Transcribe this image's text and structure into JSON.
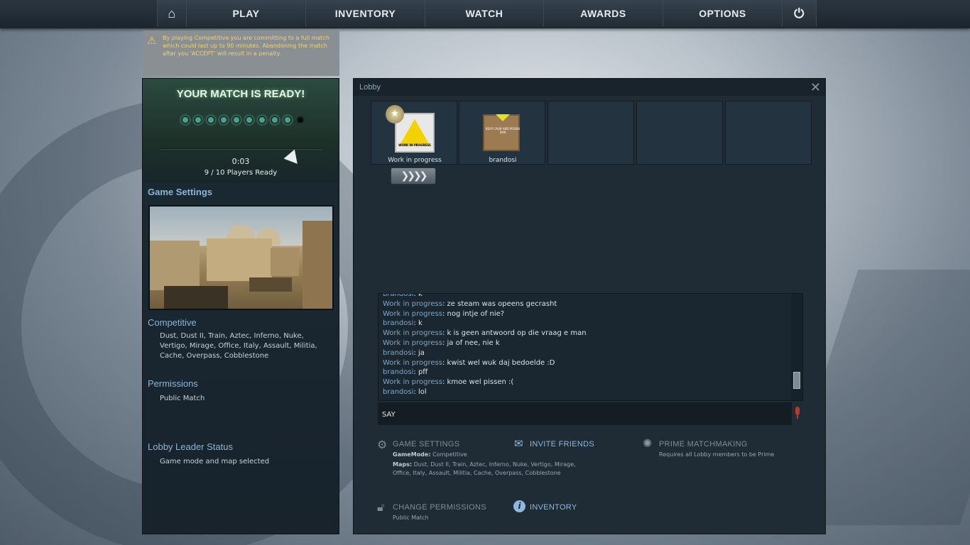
{
  "nav": {
    "home_icon": "home-icon",
    "play": "PLAY",
    "inventory": "INVENTORY",
    "watch": "WATCH",
    "awards": "AWARDS",
    "options": "OPTIONS",
    "power_icon": "power-icon"
  },
  "warning": {
    "text": "By playing Competitive you are committing to a full match which could last up to 90 minutes. Abandoning the match after you 'ACCEPT' will result in a penalty."
  },
  "match": {
    "title": "YOUR MATCH IS READY!",
    "accepted": 9,
    "total": 10,
    "timer": "0:03",
    "players_ready": "9 / 10 Players Ready"
  },
  "left": {
    "game_settings_title": "Game Settings",
    "mode_title": "Competitive",
    "maps": "Dust, Dust II, Train, Aztec, Inferno, Nuke, Vertigo, Mirage, Office, Italy, Assault, Militia, Cache, Overpass, Cobblestone",
    "permissions_title": "Permissions",
    "permissions_value": "Public Match",
    "leader_title": "Lobby Leader Status",
    "leader_value": "Game mode and map selected"
  },
  "lobby": {
    "title": "Lobby",
    "players": [
      {
        "name": "Work in progress",
        "avatar_text": "WORK IN PROGRESS"
      },
      {
        "name": "brandosi",
        "avatar_text": "KEEP CALM AND PISSEN DAN"
      }
    ],
    "empty_slots": 3,
    "rank_icon": "rank-chevrons-icon"
  },
  "chat": {
    "lines": [
      {
        "who": "brandosi",
        "msg": "k"
      },
      {
        "who": "Work in progress",
        "msg": "ze steam was opeens gecrasht"
      },
      {
        "who": "Work in progress",
        "msg": "nog intje of nie?"
      },
      {
        "who": "brandosi",
        "msg": "k"
      },
      {
        "who": "Work in progress",
        "msg": "k is geen antwoord op die vraag e man"
      },
      {
        "who": "Work in progress",
        "msg": "ja of nee, nie k"
      },
      {
        "who": "brandosi",
        "msg": "ja"
      },
      {
        "who": "Work in progress",
        "msg": "kwist wel wuk daj bedoelde :D"
      },
      {
        "who": "brandosi",
        "msg": "pff"
      },
      {
        "who": "Work in progress",
        "msg": "kmoe wel pissen :("
      },
      {
        "who": "brandosi",
        "msg": "lol"
      }
    ],
    "say_label": "SAY"
  },
  "options": {
    "game_settings": {
      "title": "GAME SETTINGS",
      "mode_label": "GameMode:",
      "mode_value": "Competitive",
      "maps_label": "Maps:",
      "maps_line1": "Dust, Dust II, Train, Aztec, Inferno, Nuke, Vertigo, Mirage,",
      "maps_line2": "Office, Italy, Assault, Militia, Cache, Overpass, Cobblestone"
    },
    "invite_friends": "INVITE FRIENDS",
    "prime": {
      "title": "PRIME MATCHMAKING",
      "sub": "Requires all Lobby members to be Prime"
    },
    "change_permissions": {
      "title": "CHANGE PERMISSIONS",
      "sub": "Public Match"
    },
    "inventory": "INVENTORY"
  },
  "colors": {
    "accent_blue": "#7fa6c8",
    "warning_text": "#f3d36a",
    "mic_red": "#b33a30"
  }
}
